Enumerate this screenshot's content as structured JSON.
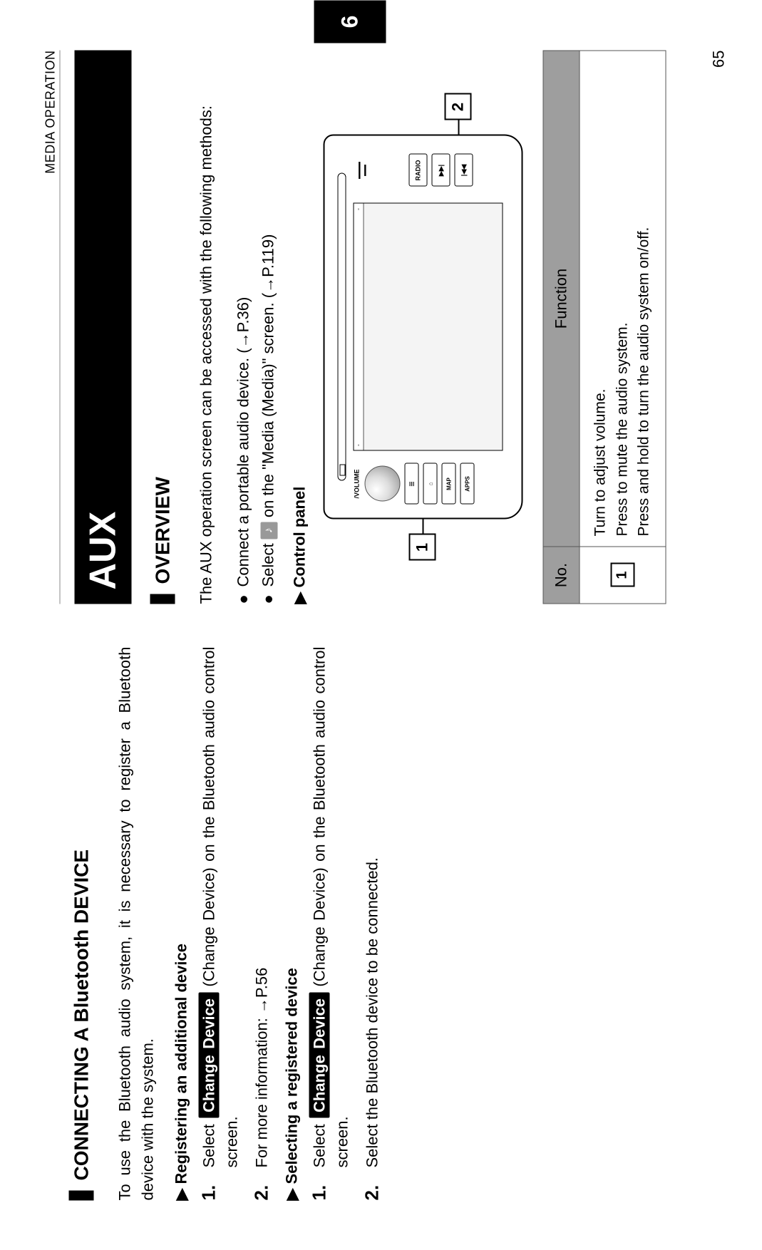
{
  "header": {
    "section_label": "MEDIA OPERATION"
  },
  "side_tab": "6",
  "page_number": "65",
  "left": {
    "title": "CONNECTING A Bluetooth DEVICE",
    "intro": "To use the Bluetooth audio system, it is necessary to register a Bluetooth device with the system.",
    "sub1": "Registering an additional device",
    "step1_pre": "Select ",
    "chip": "Change Device",
    "step1_post": " (Change Device) on the Bluetooth audio control screen.",
    "step2": "For more information: →P.56",
    "sub2": "Selecting a registered device",
    "step1b_pre": "Select ",
    "step1b_post": " (Change Device) on the Bluetooth audio control screen.",
    "step2b": "Select the Bluetooth device to be connected."
  },
  "right": {
    "big_title": "AUX",
    "overview_title": "OVERVIEW",
    "overview_text": "The AUX operation screen can be accessed with the following methods:",
    "bullet1": "Connect a portable audio device. (→P.36)",
    "bullet2_pre": "Select ",
    "bullet2_post": " on the \"Media (Media)\" screen. (→P.119)",
    "control_panel_title": "Control panel",
    "figure": {
      "knob_label": "/VOLUME",
      "btn_home_icon": "⌂",
      "btn_map": "MAP",
      "btn_apps": "APPS",
      "btn_radio": "RADIO",
      "btn_next": "▶▶|",
      "btn_prev": "|◀◀",
      "callout1": "1",
      "callout2": "2"
    },
    "table": {
      "head_no": "No.",
      "head_func": "Function",
      "row1_no": "1",
      "row1_l1": "Turn to adjust volume.",
      "row1_l2": "Press to mute the audio system.",
      "row1_l3": "Press and hold to turn the audio system on/off."
    }
  }
}
